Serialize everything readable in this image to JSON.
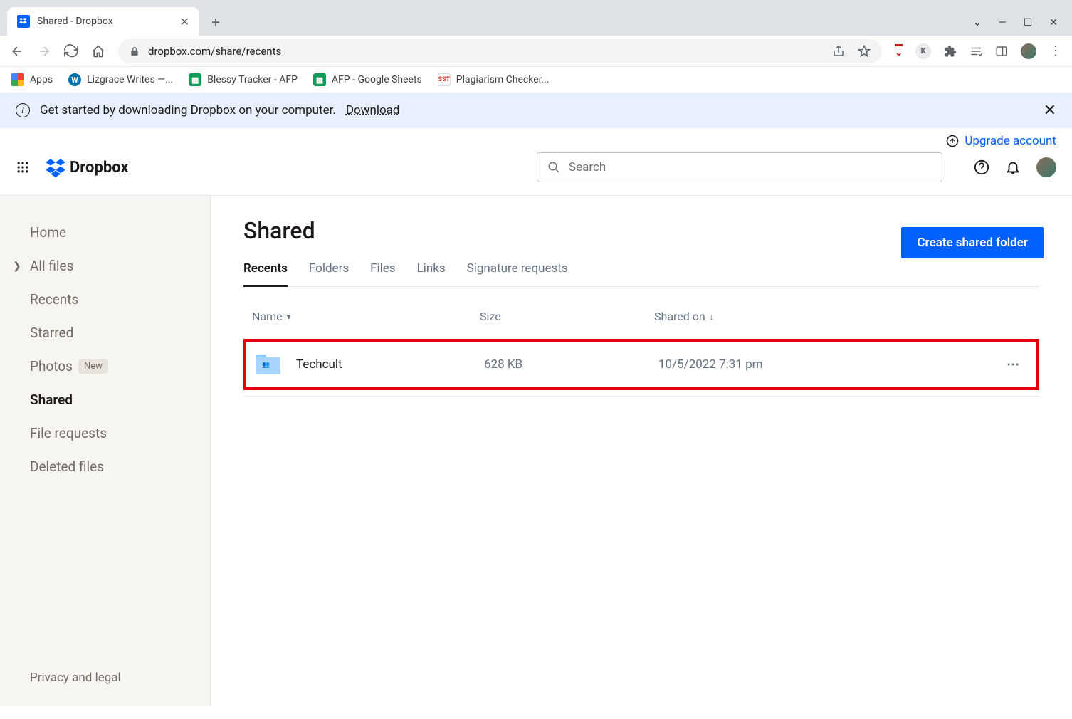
{
  "browser": {
    "tab_title": "Shared - Dropbox",
    "url": "dropbox.com/share/recents",
    "bookmarks": [
      {
        "label": "Apps"
      },
      {
        "label": "Lizgrace Writes —..."
      },
      {
        "label": "Blessy Tracker - AFP"
      },
      {
        "label": "AFP - Google Sheets"
      },
      {
        "label": "Plagiarism Checker..."
      }
    ]
  },
  "banner": {
    "text": "Get started by downloading Dropbox on your computer.",
    "link": "Download"
  },
  "upgrade_label": "Upgrade account",
  "brand": "Dropbox",
  "search": {
    "placeholder": "Search"
  },
  "sidebar": {
    "items": [
      {
        "label": "Home"
      },
      {
        "label": "All files"
      },
      {
        "label": "Recents"
      },
      {
        "label": "Starred"
      },
      {
        "label": "Photos",
        "badge": "New"
      },
      {
        "label": "Shared"
      },
      {
        "label": "File requests"
      },
      {
        "label": "Deleted files"
      }
    ],
    "footer": "Privacy and legal"
  },
  "page": {
    "title": "Shared",
    "tabs": [
      "Recents",
      "Folders",
      "Files",
      "Links",
      "Signature requests"
    ],
    "create_button": "Create shared folder",
    "columns": {
      "name": "Name",
      "size": "Size",
      "shared": "Shared on"
    },
    "rows": [
      {
        "name": "Techcult",
        "size": "628 KB",
        "shared": "10/5/2022 7:31 pm"
      }
    ]
  }
}
